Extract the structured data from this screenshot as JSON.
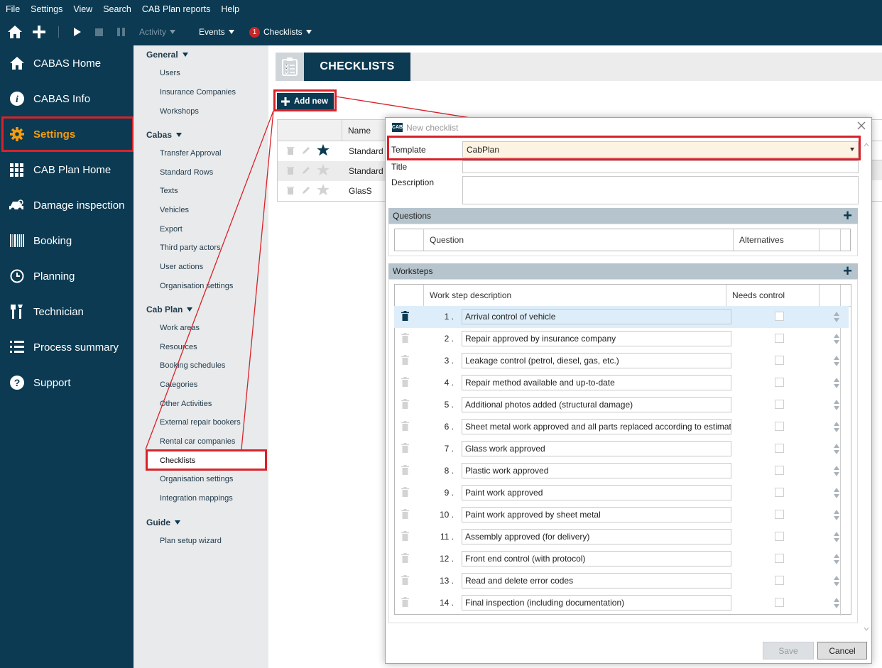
{
  "menubar": {
    "items": [
      "File",
      "Settings",
      "View",
      "Search",
      "CAB Plan reports",
      "Help"
    ]
  },
  "toolbar": {
    "activity": "Activity",
    "events": "Events",
    "checklists_badge": "1",
    "checklists": "Checklists"
  },
  "sidebar": {
    "items": [
      "CABAS Home",
      "CABAS Info",
      "Settings",
      "CAB Plan Home",
      "Damage inspection",
      "Booking",
      "Planning",
      "Technician",
      "Process summary",
      "Support"
    ]
  },
  "subnav": {
    "general": {
      "title": "General",
      "items": [
        "Users",
        "Insurance Companies",
        "Workshops"
      ]
    },
    "cabas": {
      "title": "Cabas",
      "items": [
        "Transfer Approval",
        "Standard Rows",
        "Texts",
        "Vehicles",
        "Export",
        "Third party actors",
        "User actions",
        "Organisation settings"
      ]
    },
    "cabplan": {
      "title": "Cab Plan",
      "items": [
        "Work areas",
        "Resources",
        "Booking schedules",
        "Categories",
        "Other Activities",
        "External repair bookers",
        "Rental car companies",
        "Checklists",
        "Organisation settings",
        "Integration mappings"
      ]
    },
    "guide": {
      "title": "Guide",
      "items": [
        "Plan setup wizard"
      ]
    }
  },
  "page": {
    "title": "CHECKLISTS",
    "add_new": "Add new"
  },
  "list": {
    "header_name": "Name",
    "rows": [
      "Standard",
      "Standard",
      "GlasS"
    ]
  },
  "dialog": {
    "logo": "CAB",
    "title": "New checklist",
    "template_label": "Template",
    "template_value": "CabPlan",
    "title_label": "Title",
    "description_label": "Description",
    "questions_title": "Questions",
    "question_col": "Question",
    "alternatives_col": "Alternatives",
    "worksteps_title": "Worksteps",
    "workstep_col": "Work step description",
    "needs_control_col": "Needs control",
    "worksteps": [
      {
        "num": "1 .",
        "text": "Arrival control of vehicle"
      },
      {
        "num": "2 .",
        "text": "Repair approved by insurance company"
      },
      {
        "num": "3 .",
        "text": "Leakage control (petrol, diesel, gas, etc.)"
      },
      {
        "num": "4 .",
        "text": "Repair method available and up-to-date"
      },
      {
        "num": "5 .",
        "text": "Additional photos added (structural damage)"
      },
      {
        "num": "6 .",
        "text": "Sheet metal work approved and all parts replaced according to estimate"
      },
      {
        "num": "7 .",
        "text": "Glass work approved"
      },
      {
        "num": "8 .",
        "text": "Plastic work approved"
      },
      {
        "num": "9 .",
        "text": "Paint work approved"
      },
      {
        "num": "10 .",
        "text": "Paint work approved by sheet metal"
      },
      {
        "num": "11 .",
        "text": "Assembly approved (for delivery)"
      },
      {
        "num": "12 .",
        "text": "Front end control (with protocol)"
      },
      {
        "num": "13 .",
        "text": "Read and delete error codes"
      },
      {
        "num": "14 .",
        "text": "Final inspection (including documentation)"
      }
    ],
    "save": "Save",
    "cancel": "Cancel"
  },
  "colors": {
    "navy": "#0b3a52",
    "highlight": "#d8222a",
    "active": "#f39c12"
  }
}
